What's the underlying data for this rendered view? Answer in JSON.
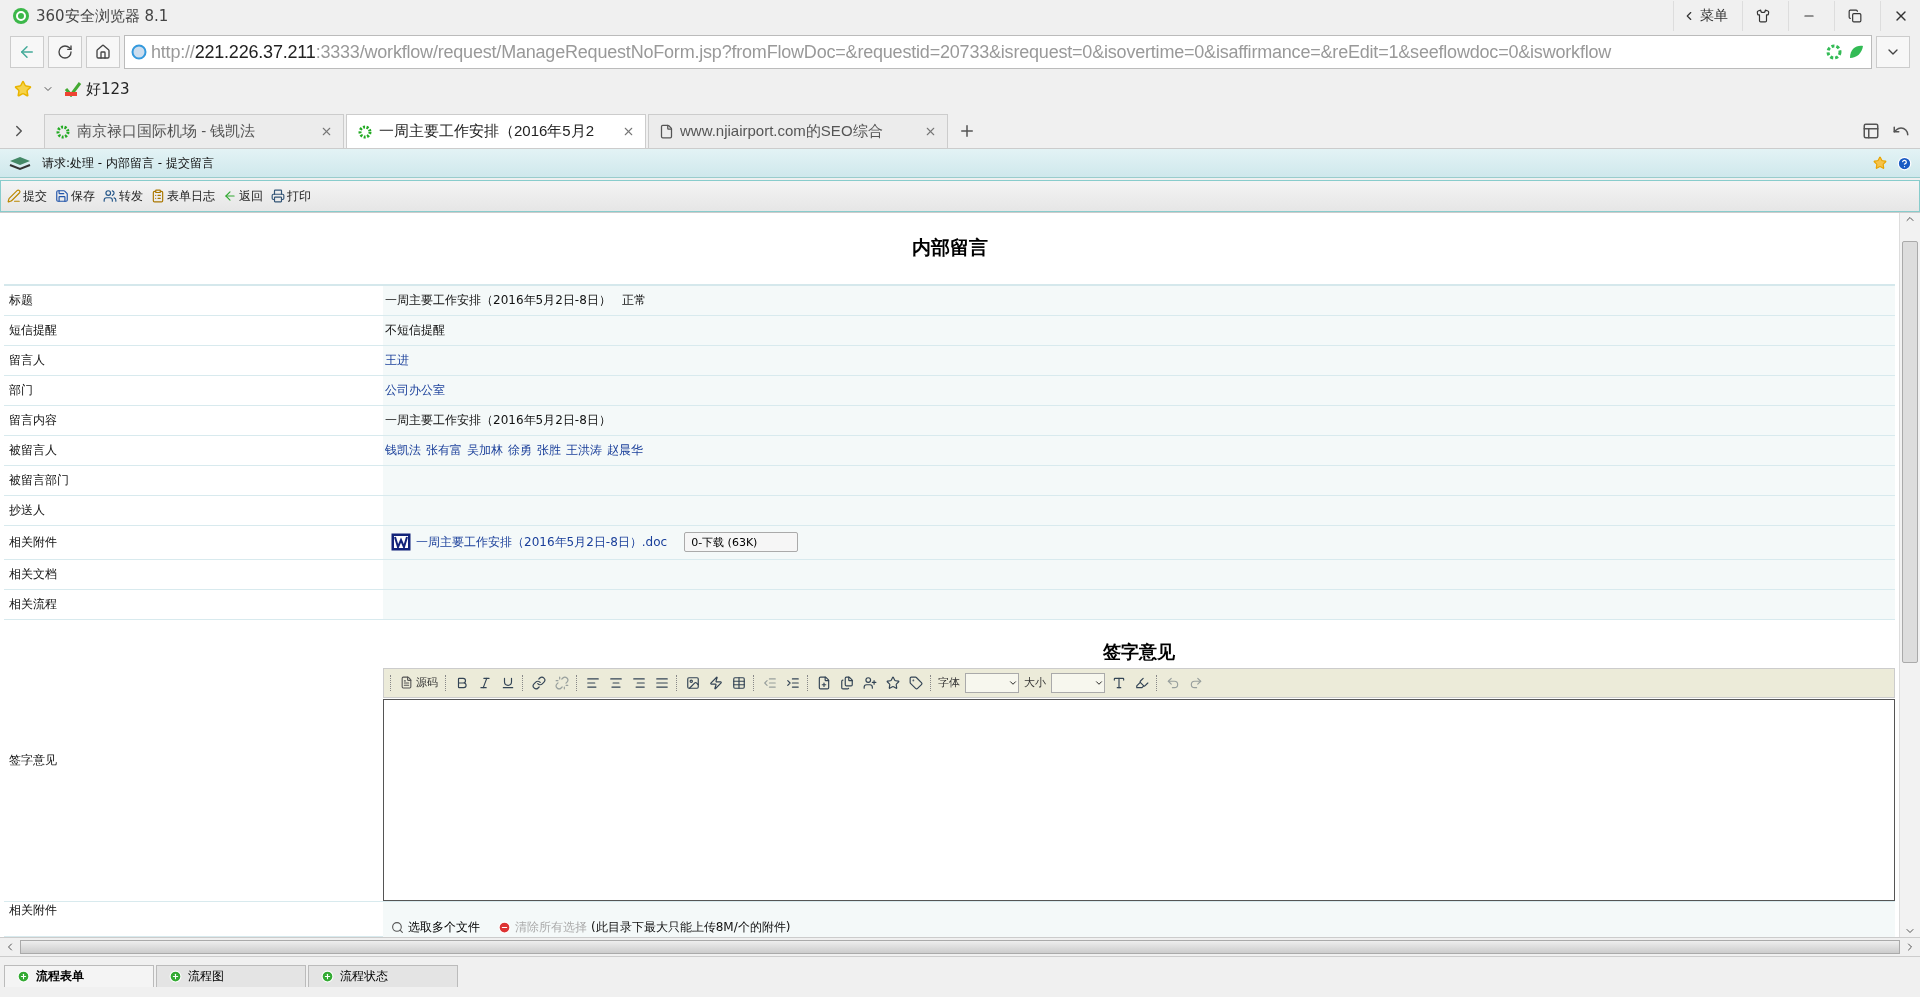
{
  "window": {
    "title": "360安全浏览器 8.1",
    "menu": "菜单"
  },
  "address": {
    "scheme": "http://",
    "host": "221.226.37.211",
    "rest": ":3333/workflow/request/ManageRequestNoForm.jsp?fromFlowDoc=&requestid=20733&isrequest=0&isovertime=0&isaffirmance=&reEdit=1&seeflowdoc=0&isworkflow"
  },
  "bookmarks": [
    {
      "label": "好123"
    }
  ],
  "tabs": [
    {
      "label": "南京禄口国际机场 - 钱凯法",
      "kind": "app",
      "selected": false
    },
    {
      "label": "一周主要工作安排（2016年5月2",
      "kind": "app",
      "selected": true
    },
    {
      "label": "www.njiairport.com的SEO综合",
      "kind": "page",
      "selected": false
    }
  ],
  "breadcrumb": "请求:处理 - 内部留言 - 提交留言",
  "toolbar": [
    {
      "label": "提交",
      "kind": "submit"
    },
    {
      "label": "保存",
      "kind": "save"
    },
    {
      "label": "转发",
      "kind": "forward"
    },
    {
      "label": "表单日志",
      "kind": "log"
    },
    {
      "label": "返回",
      "kind": "back"
    },
    {
      "label": "打印",
      "kind": "print"
    }
  ],
  "form": {
    "title": "内部留言",
    "rows": [
      {
        "label": "标题",
        "kind": "text",
        "value": "一周主要工作安排（2016年5月2日-8日）",
        "extra": "正常"
      },
      {
        "label": "短信提醒",
        "kind": "text",
        "value": "不短信提醒"
      },
      {
        "label": "留言人",
        "kind": "links",
        "values": [
          "王进"
        ]
      },
      {
        "label": "部门",
        "kind": "links",
        "values": [
          "公司办公室"
        ]
      },
      {
        "label": "留言内容",
        "kind": "text",
        "value": "一周主要工作安排（2016年5月2日-8日）"
      },
      {
        "label": "被留言人",
        "kind": "links",
        "values": [
          "钱凯法",
          "张有富",
          "吴加林",
          "徐勇",
          "张胜",
          "王洪涛",
          "赵晨华"
        ]
      },
      {
        "label": "被留言部门",
        "kind": "empty"
      },
      {
        "label": "抄送人",
        "kind": "empty"
      },
      {
        "label": "相关附件",
        "kind": "attachment",
        "file": "一周主要工作安排（2016年5月2日-8日）.doc",
        "download": "0-下载 (63K)"
      },
      {
        "label": "相关文档",
        "kind": "empty"
      },
      {
        "label": "相关流程",
        "kind": "empty"
      }
    ],
    "sign": {
      "heading": "签字意见",
      "label": "签字意见",
      "tools": [
        {
          "kind": "sep"
        },
        {
          "kind": "source",
          "label": "源码",
          "disabled": false
        },
        {
          "kind": "sep"
        },
        {
          "kind": "bold",
          "disabled": false
        },
        {
          "kind": "italic",
          "disabled": false
        },
        {
          "kind": "underline",
          "disabled": false
        },
        {
          "kind": "sep"
        },
        {
          "kind": "link",
          "disabled": false
        },
        {
          "kind": "unlink",
          "disabled": true
        },
        {
          "kind": "sep"
        },
        {
          "kind": "align-left",
          "disabled": false
        },
        {
          "kind": "align-center",
          "disabled": false
        },
        {
          "kind": "align-right",
          "disabled": false
        },
        {
          "kind": "justify",
          "disabled": false
        },
        {
          "kind": "sep"
        },
        {
          "kind": "image",
          "disabled": false
        },
        {
          "kind": "flash",
          "disabled": false
        },
        {
          "kind": "table",
          "disabled": false
        },
        {
          "kind": "sep"
        },
        {
          "kind": "outdent",
          "disabled": true
        },
        {
          "kind": "indent",
          "disabled": false
        },
        {
          "kind": "sep"
        },
        {
          "kind": "doc-add",
          "disabled": false
        },
        {
          "kind": "docs",
          "disabled": false
        },
        {
          "kind": "users",
          "disabled": false
        },
        {
          "kind": "star-add",
          "disabled": false
        },
        {
          "kind": "tag",
          "disabled": false
        },
        {
          "kind": "sep"
        },
        {
          "kind": "select",
          "label": "字体",
          "disabled": false
        },
        {
          "kind": "select",
          "label": "大小",
          "disabled": false
        },
        {
          "kind": "font-color",
          "disabled": false
        },
        {
          "kind": "bg-color",
          "disabled": false
        },
        {
          "kind": "sep"
        },
        {
          "kind": "undo",
          "disabled": true
        },
        {
          "kind": "redo",
          "disabled": true
        }
      ]
    },
    "attach": {
      "label": "相关附件",
      "pick": "选取多个文件",
      "clear": "清除所有选择",
      "note": "(此目录下最大只能上传8M/个的附件)"
    }
  },
  "bottom_tabs": [
    {
      "label": "流程表单",
      "selected": true
    },
    {
      "label": "流程图",
      "selected": false
    },
    {
      "label": "流程状态",
      "selected": false
    }
  ]
}
